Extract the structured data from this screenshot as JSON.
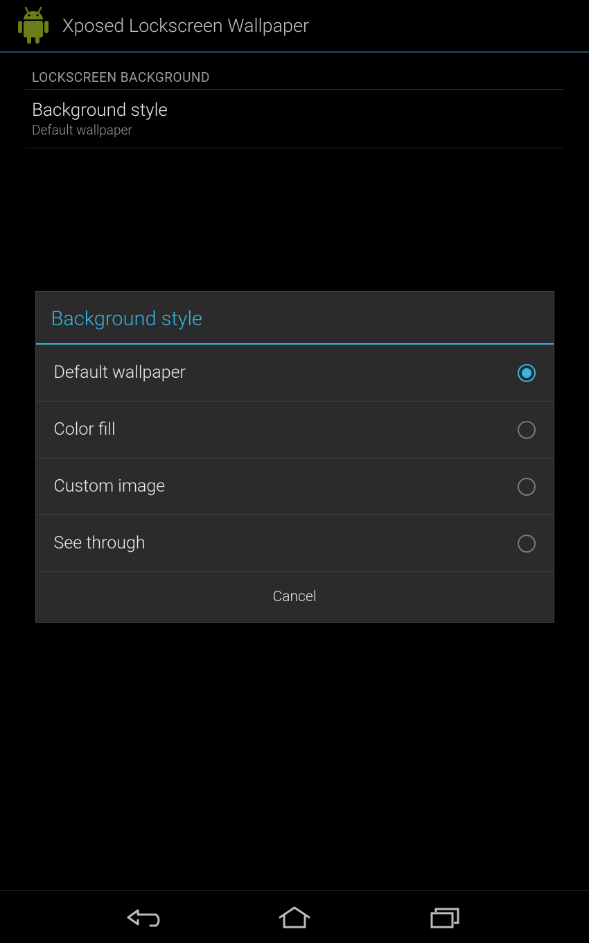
{
  "app": {
    "title": "Xposed Lockscreen Wallpaper"
  },
  "section": {
    "header": "LOCKSCREEN BACKGROUND"
  },
  "pref": {
    "title": "Background style",
    "summary": "Default wallpaper"
  },
  "dialog": {
    "title": "Background style",
    "options": [
      {
        "label": "Default wallpaper",
        "selected": true
      },
      {
        "label": "Color fill",
        "selected": false
      },
      {
        "label": "Custom image",
        "selected": false
      },
      {
        "label": "See through",
        "selected": false
      }
    ],
    "cancel": "Cancel"
  },
  "colors": {
    "accent": "#33b5e5"
  }
}
